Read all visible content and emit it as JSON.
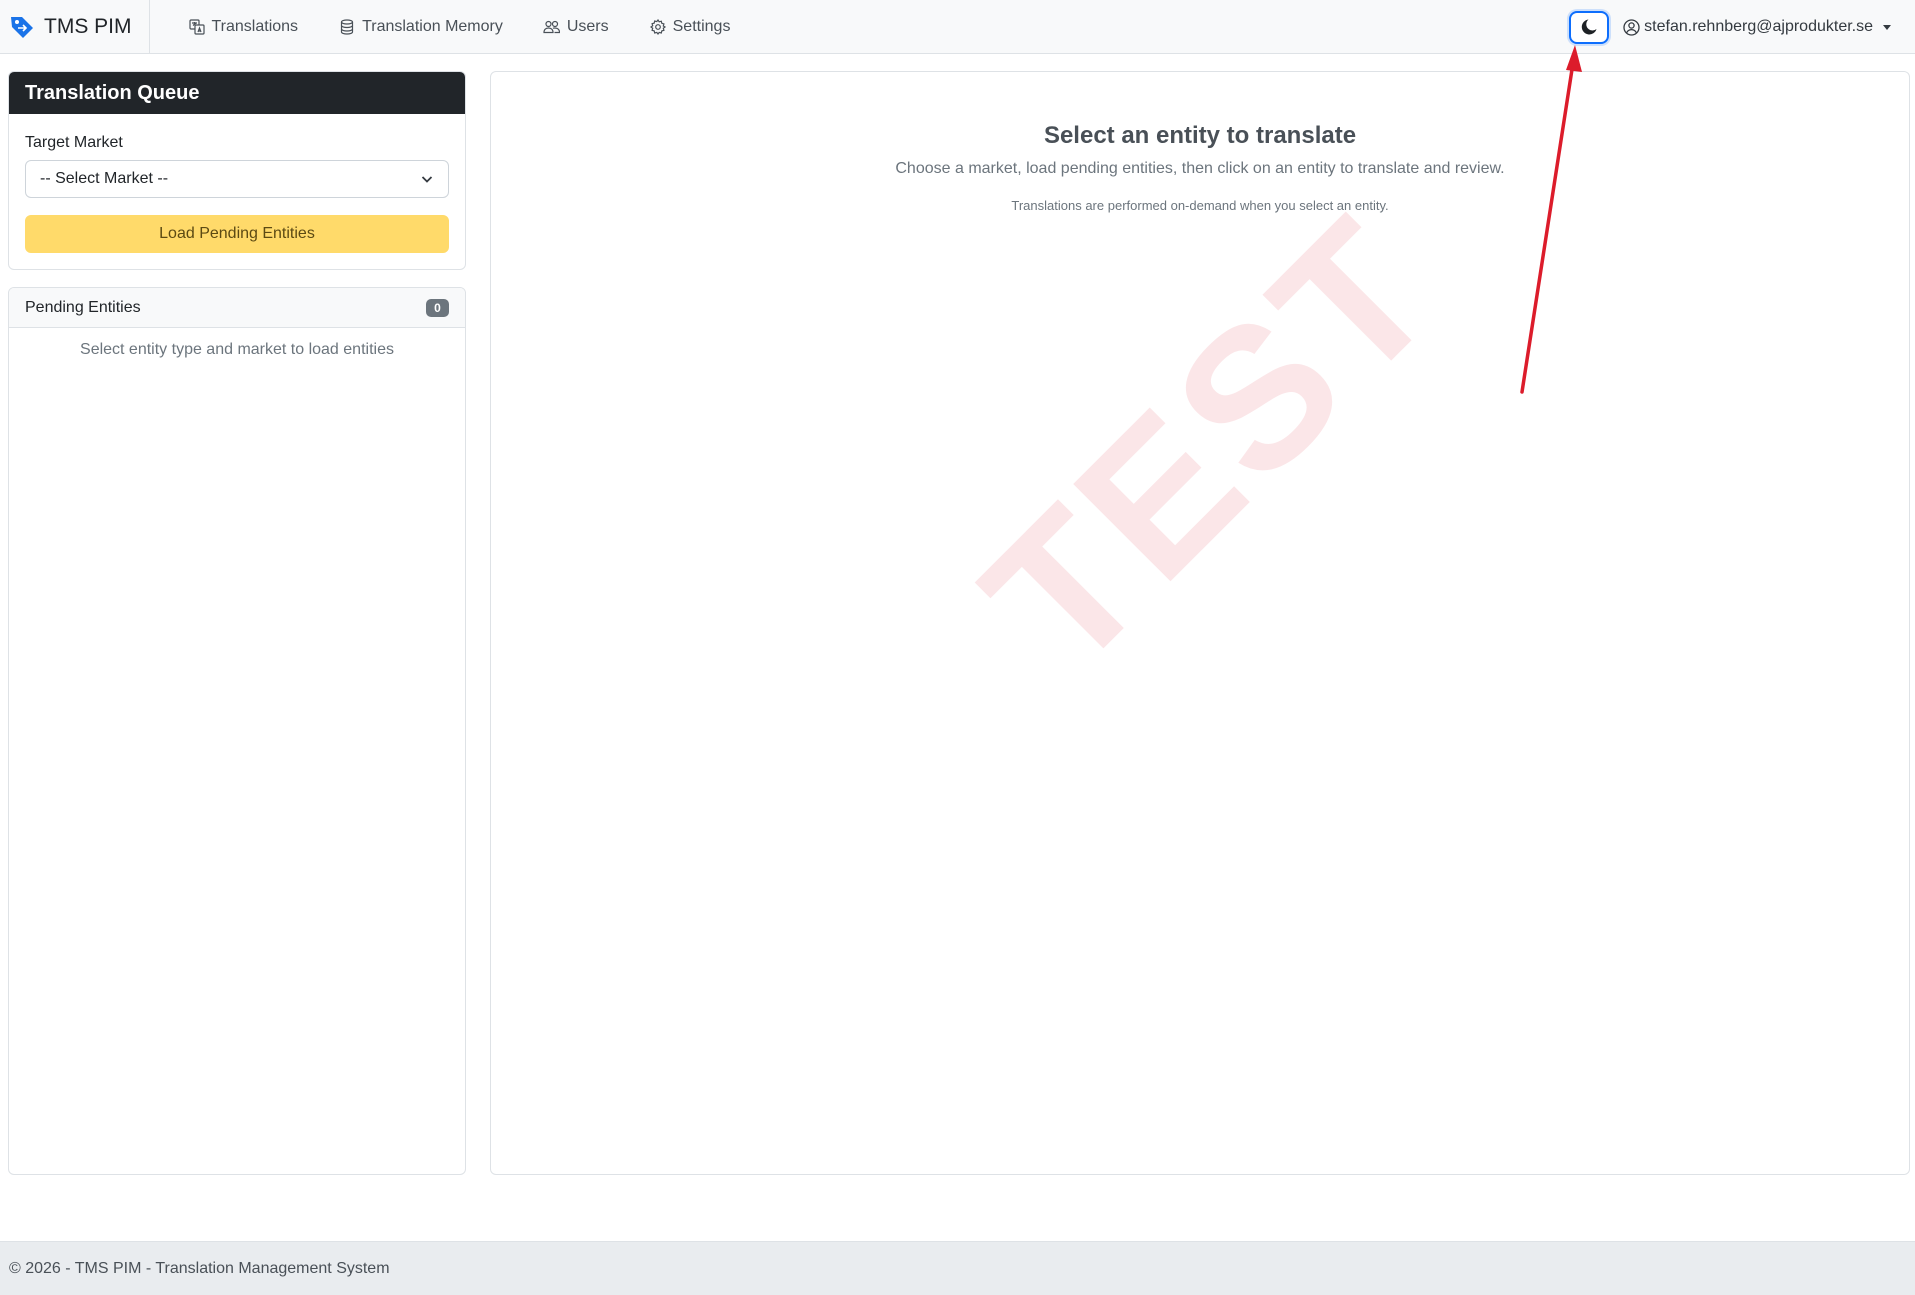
{
  "navbar": {
    "brand": "TMS PIM",
    "brand_icon": "tag-icon",
    "links": [
      {
        "label": "Translations",
        "icon": "translate-icon"
      },
      {
        "label": "Translation Memory",
        "icon": "database-icon"
      },
      {
        "label": "Users",
        "icon": "people-icon"
      },
      {
        "label": "Settings",
        "icon": "gear-icon"
      }
    ],
    "theme_toggle_icon": "moon-icon",
    "user": {
      "email": "stefan.rehnberg@ajprodukter.se",
      "icon": "person-circle-icon"
    }
  },
  "queue": {
    "title": "Translation Queue",
    "target_market_label": "Target Market",
    "market_select": {
      "selected": "-- Select Market --"
    },
    "load_button": "Load Pending Entities"
  },
  "pending": {
    "title": "Pending Entities",
    "count": "0",
    "empty_text": "Select entity type and market to load entities"
  },
  "main": {
    "title": "Select an entity to translate",
    "description": "Choose a market, load pending entities, then click on an entity to translate and review.",
    "note": "Translations are performed on-demand when you select an entity.",
    "watermark": "TEST"
  },
  "footer": {
    "text": "© 2026 - TMS PIM - Translation Management System"
  },
  "colors": {
    "primary": "#0d6efd",
    "warning": "#ffda6a",
    "dark_header": "#212529",
    "annotation_red": "#dc1c2b",
    "watermark": "#dc3545"
  }
}
